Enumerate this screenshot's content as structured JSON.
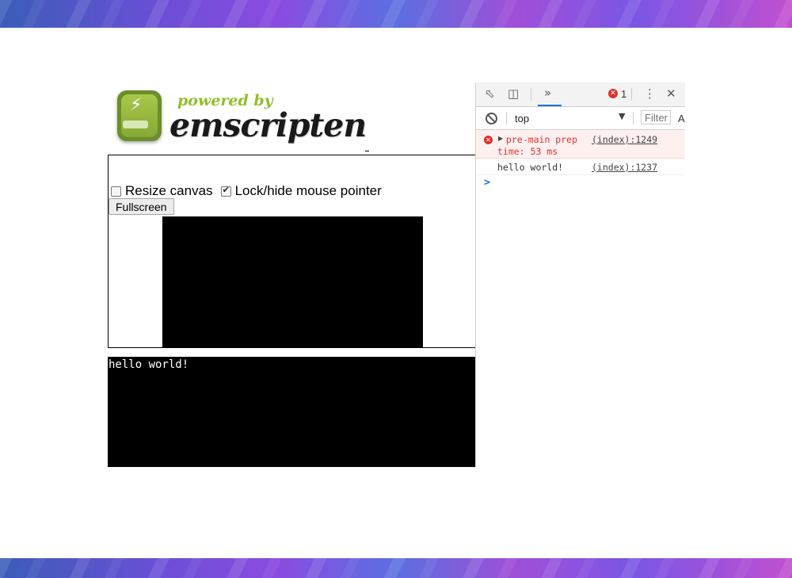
{
  "logo": {
    "tagline": "powered by",
    "name": "emscripten"
  },
  "controls": {
    "resize_label": "Resize canvas",
    "resize_checked": false,
    "lock_label": "Lock/hide mouse pointer",
    "lock_checked": true,
    "fullscreen_label": "Fullscreen"
  },
  "output": {
    "text": "hello world!"
  },
  "devtools": {
    "error_count": "1",
    "context": "top",
    "filter_placeholder": "Filter",
    "filter_more": "A",
    "messages": [
      {
        "level": "error",
        "line1": "pre-main prep",
        "line2": "time: 53 ms",
        "source": "(index):1249"
      },
      {
        "level": "info",
        "text": "hello world!",
        "source": "(index):1237"
      }
    ],
    "prompt": ">"
  },
  "colors": {
    "brand_green": "#8fbf2a",
    "error_red": "#e0322f",
    "devtools_accent": "#1a73e8"
  }
}
